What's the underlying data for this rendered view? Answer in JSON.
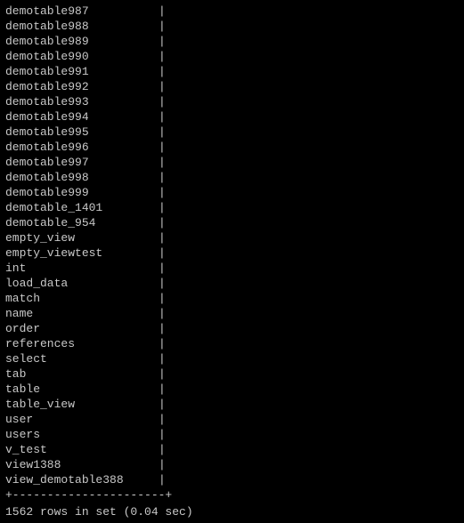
{
  "table": {
    "rows": [
      "demotable987",
      "demotable988",
      "demotable989",
      "demotable990",
      "demotable991",
      "demotable992",
      "demotable993",
      "demotable994",
      "demotable995",
      "demotable996",
      "demotable997",
      "demotable998",
      "demotable999",
      "demotable_1401",
      "demotable_954",
      "empty_view",
      "empty_viewtest",
      "int",
      "load_data",
      "match",
      "name",
      "order",
      "references",
      "select",
      "tab",
      "table",
      "table_view",
      "user",
      "users",
      "v_test",
      "view1388",
      "view_demotable388"
    ],
    "divider": "+----------------------+",
    "footer": "1562 rows in set (0.04 sec)"
  }
}
